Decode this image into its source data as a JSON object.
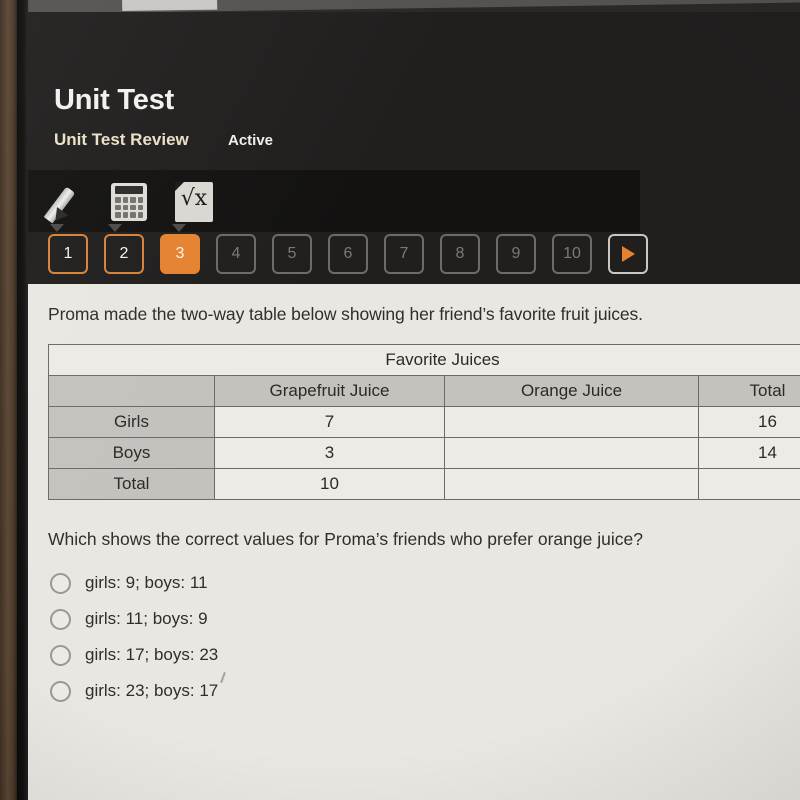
{
  "header": {
    "title": "Unit Test",
    "subtitle": "Unit Test Review",
    "status": "Active",
    "accent_color": "#e5822f",
    "background_color": "#211f1e",
    "subtitle_color": "#e9e0c6"
  },
  "tools": [
    {
      "name": "pencil-tool",
      "label": "Pencil"
    },
    {
      "name": "calculator-tool",
      "label": "Calculator"
    },
    {
      "name": "formula-tool",
      "label": "√x"
    }
  ],
  "question_nav": {
    "items": [
      {
        "label": "1",
        "state": "done"
      },
      {
        "label": "2",
        "state": "done"
      },
      {
        "label": "3",
        "state": "current"
      },
      {
        "label": "4",
        "state": "todo"
      },
      {
        "label": "5",
        "state": "todo"
      },
      {
        "label": "6",
        "state": "todo"
      },
      {
        "label": "7",
        "state": "todo"
      },
      {
        "label": "8",
        "state": "todo"
      },
      {
        "label": "9",
        "state": "todo"
      },
      {
        "label": "10",
        "state": "todo"
      }
    ],
    "next_label": "next-question"
  },
  "content": {
    "prompt": "Proma made the two-way table below showing her friend’s favorite fruit juices.",
    "question": "Which shows the correct values for Proma’s friends who prefer orange juice?"
  },
  "table": {
    "caption": "Favorite Juices",
    "column_headers": [
      "",
      "Grapefruit Juice",
      "Orange Juice",
      "Total"
    ],
    "rows": [
      {
        "label": "Girls",
        "grapefruit": "7",
        "orange": "",
        "total": "16"
      },
      {
        "label": "Boys",
        "grapefruit": "3",
        "orange": "",
        "total": "14"
      },
      {
        "label": "Total",
        "grapefruit": "10",
        "orange": "",
        "total": ""
      }
    ]
  },
  "choices": [
    {
      "label": "girls: 9; boys: 11",
      "selected": false
    },
    {
      "label": "girls: 11; boys: 9",
      "selected": false
    },
    {
      "label": "girls: 17; boys: 23",
      "selected": false
    },
    {
      "label": "girls: 23; boys: 17",
      "selected": false
    }
  ]
}
